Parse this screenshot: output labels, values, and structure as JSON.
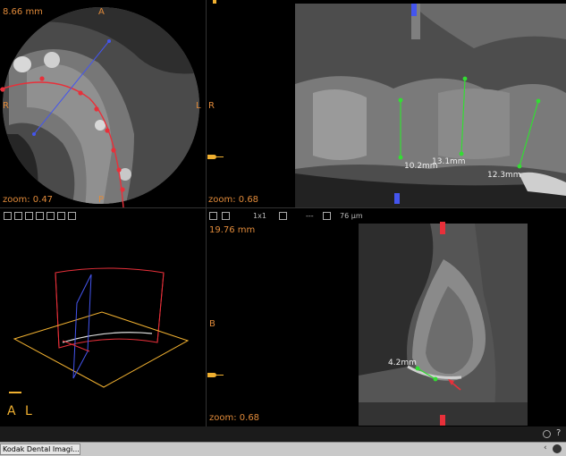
{
  "top_left": {
    "measure": "8.66 mm",
    "orient_top": "A",
    "orient_left": "R",
    "orient_right": "L",
    "orient_bottom": "P",
    "zoom": "zoom: 0.47"
  },
  "top_right": {
    "orient_left": "R",
    "zoom": "zoom: 0.68",
    "measurements": [
      "10.2mm",
      "13.1mm",
      "12.3mm"
    ]
  },
  "bottom_left": {
    "orient_a": "A",
    "orient_l": "L"
  },
  "bottom_right": {
    "toolbar_ratio": "1x1",
    "toolbar_dots": "---",
    "toolbar_size": "76 µm",
    "measure": "19.76 mm",
    "orient_b": "B",
    "zoom": "zoom: 0.68",
    "measurement": "4.2mm"
  },
  "taskbar": {
    "app_label": "Kodak Dental Imagi..."
  },
  "colors": {
    "measure_line": "#33dd33",
    "curve": "#e8303a",
    "axis_blue": "#4455ee",
    "label_orange": "#e08a3a"
  }
}
